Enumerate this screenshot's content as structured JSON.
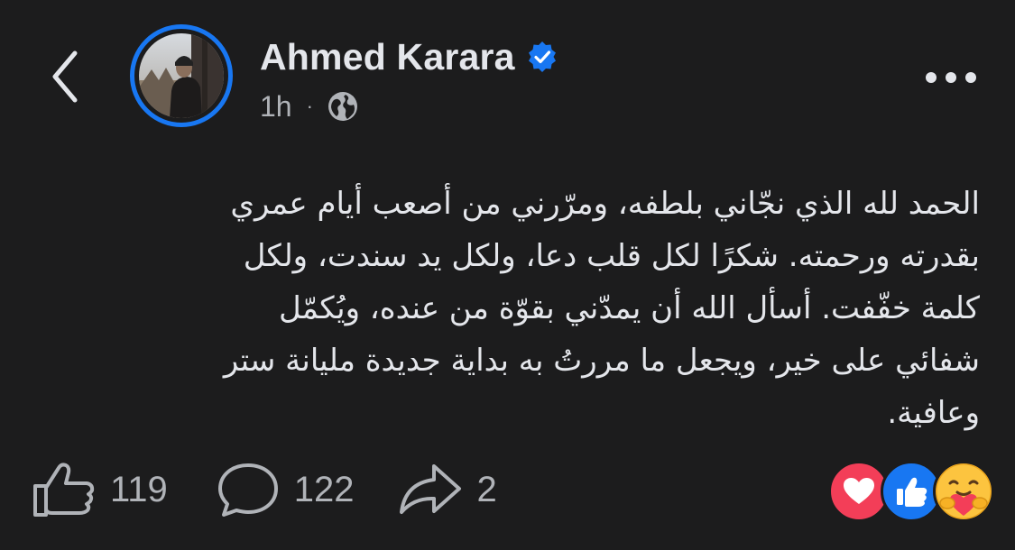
{
  "post": {
    "author": "Ahmed Karara",
    "verified": true,
    "timestamp": "1h",
    "separator": "·",
    "audience_icon": "globe-icon",
    "body_lines": [
      "الحمد لله الذي نجّاني بلطفه، ومرّرني من أصعب أيام عمري",
      "بقدرته ورحمته. شكرًا لكل قلب دعا، ولكل يد سندت، ولكل",
      "كلمة خفّفت. أسأل الله أن يمدّني بقوّة من عنده، ويُكمّل",
      "شفائي على خير، ويجعل ما مررتُ به بداية جديدة مليانة ستر",
      "وعافية."
    ]
  },
  "actions": {
    "like_count": "119",
    "comment_count": "122",
    "share_count": "2"
  },
  "reactions": [
    "love-reaction-icon",
    "like-reaction-icon",
    "care-reaction-icon"
  ],
  "colors": {
    "background": "#1c1c1d",
    "accent": "#1877f2",
    "text_primary": "#e4e6eb",
    "text_secondary": "#b0b3b8",
    "love": "#f33e58"
  }
}
